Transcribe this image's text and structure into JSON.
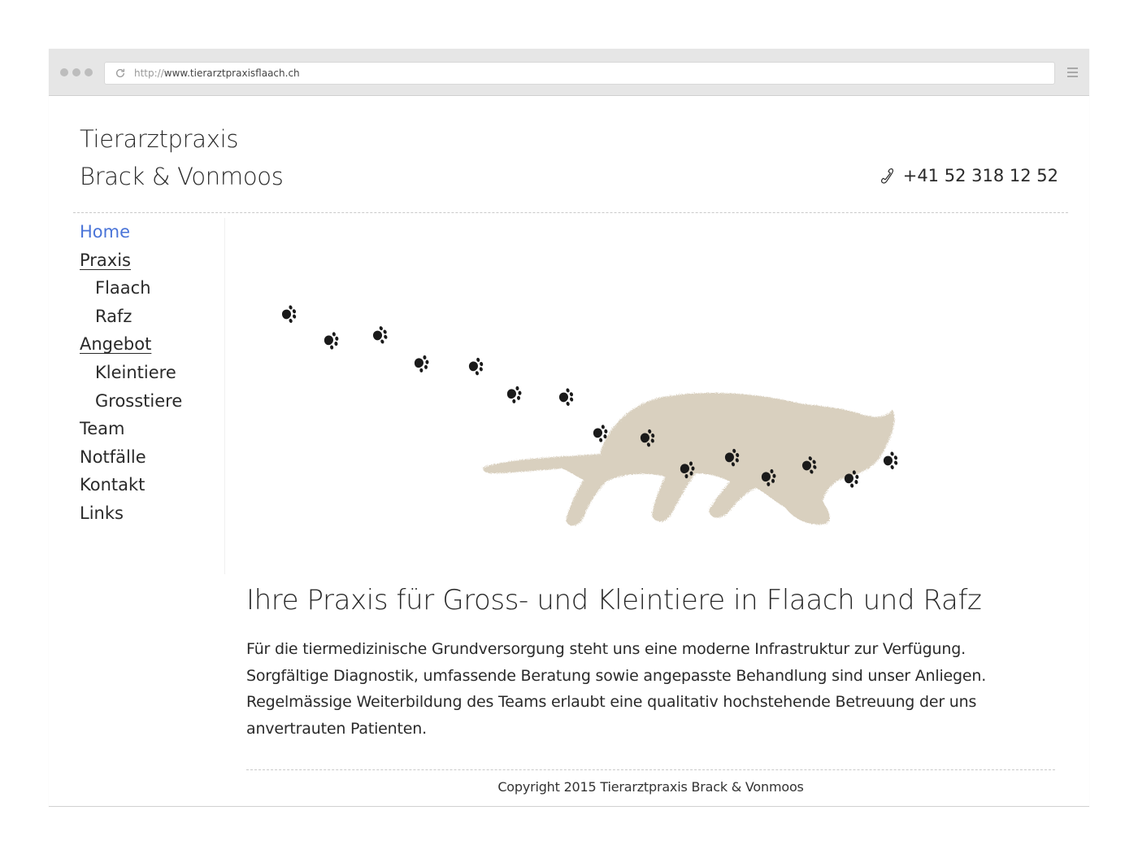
{
  "browser": {
    "url_protocol": "http://",
    "url_host": "www.tierarztpraxisflaach.ch"
  },
  "header": {
    "title_line1": "Tierarztpraxis",
    "title_line2": "Brack & Vonmoos",
    "phone": "+41 52 318 12 52",
    "phone_icon": "phone-handset-icon"
  },
  "nav": {
    "items": [
      {
        "label": "Home"
      },
      {
        "label": "Praxis"
      },
      {
        "label": "Flaach"
      },
      {
        "label": "Rafz"
      },
      {
        "label": "Angebot"
      },
      {
        "label": "Kleintiere"
      },
      {
        "label": "Grosstiere"
      },
      {
        "label": "Team"
      },
      {
        "label": "Notfälle"
      },
      {
        "label": "Kontakt"
      },
      {
        "label": "Links"
      }
    ]
  },
  "main": {
    "headline": "Ihre Praxis für Gross- und Kleintiere in Flaach und Rafz",
    "intro": "Für die tiermedizinische Grundversorgung steht uns eine moderne Infrastruktur zur Verfügung. Sorgfältige Diagnostik, umfassende Beratung sowie angepasste Behandlung sind unser Anliegen. Regelmässige Weiterbildung des Teams erlaubt eine qualitativ hochstehende Betreuung der uns anvertrauten Patienten."
  },
  "footer": {
    "copyright": "Copyright 2015 Tierarztpraxis Brack & Vonmoos"
  },
  "colors": {
    "link_active": "#4a74d8",
    "cat_silhouette": "#d9d0bf",
    "pawprint": "#1a1a1a"
  }
}
